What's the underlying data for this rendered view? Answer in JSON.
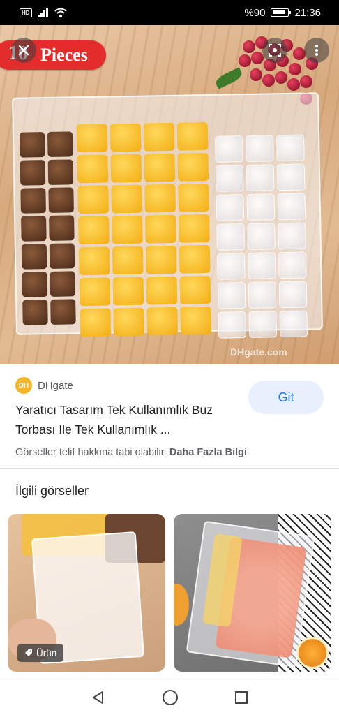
{
  "status_bar": {
    "battery": "%90",
    "time": "21:36",
    "hd_label": "HD"
  },
  "hero": {
    "badge_number": "10",
    "badge_text": "Pieces",
    "watermark": "DHgate.com"
  },
  "result": {
    "source": "DHgate",
    "source_logo_text": "DH",
    "title": "Yaratıcı Tasarım Tek Kullanımlık Buz Torbası Ile Tek Kullanımlık ...",
    "go_button": "Git",
    "copyright_text": "Görseller telif hakkına tabi olabilir.",
    "copyright_link": "Daha Fazla Bilgi"
  },
  "related": {
    "title": "İlgili görseller",
    "items": [
      {
        "tag": "Ürün"
      },
      {
        "tag": ""
      }
    ]
  },
  "icons": [
    "close-icon",
    "lens-icon",
    "more-vert-icon",
    "tag-icon",
    "back-icon",
    "home-icon",
    "recents-icon"
  ]
}
